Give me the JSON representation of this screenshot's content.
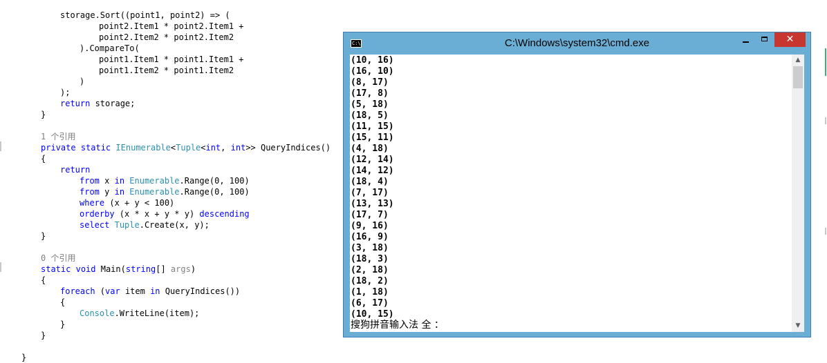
{
  "editor": {
    "lines": [
      {
        "segments": [
          {
            "t": "storage.Sort((point1, point2) => (",
            "c": ""
          }
        ]
      },
      {
        "segments": [
          {
            "t": "point2.Item1 * point2.Item1 +",
            "c": ""
          }
        ]
      },
      {
        "segments": [
          {
            "t": "point2.Item2 * point2.Item2",
            "c": ""
          }
        ]
      },
      {
        "segments": [
          {
            "t": ").CompareTo(",
            "c": ""
          }
        ]
      },
      {
        "segments": [
          {
            "t": "point1.Item1 * point1.Item1 +",
            "c": ""
          }
        ]
      },
      {
        "segments": [
          {
            "t": "point1.Item2 * point1.Item2",
            "c": ""
          }
        ]
      },
      {
        "segments": [
          {
            "t": ")",
            "c": ""
          }
        ]
      },
      {
        "segments": [
          {
            "t": ");",
            "c": ""
          }
        ]
      },
      {
        "segments": [
          {
            "t": "return",
            "c": "kw"
          },
          {
            "t": " storage;",
            "c": ""
          }
        ]
      },
      {
        "segments": [
          {
            "t": "}",
            "c": ""
          }
        ]
      },
      {
        "segments": [
          {
            "t": "1 个引用",
            "c": "gy"
          }
        ]
      },
      {
        "segments": [
          {
            "t": "private",
            "c": "kw"
          },
          {
            "t": " ",
            "c": ""
          },
          {
            "t": "static",
            "c": "kw"
          },
          {
            "t": " ",
            "c": ""
          },
          {
            "t": "IEnumerable",
            "c": "ty"
          },
          {
            "t": "<",
            "c": ""
          },
          {
            "t": "Tuple",
            "c": "ty"
          },
          {
            "t": "<",
            "c": ""
          },
          {
            "t": "int",
            "c": "kw"
          },
          {
            "t": ", ",
            "c": ""
          },
          {
            "t": "int",
            "c": "kw"
          },
          {
            "t": ">> QueryIndices()",
            "c": ""
          }
        ]
      },
      {
        "segments": [
          {
            "t": "{",
            "c": ""
          }
        ]
      },
      {
        "segments": [
          {
            "t": "return",
            "c": "kw"
          }
        ]
      },
      {
        "segments": [
          {
            "t": "from",
            "c": "kw"
          },
          {
            "t": " x ",
            "c": ""
          },
          {
            "t": "in",
            "c": "kw"
          },
          {
            "t": " ",
            "c": ""
          },
          {
            "t": "Enumerable",
            "c": "ty"
          },
          {
            "t": ".Range(0, 100)",
            "c": ""
          }
        ]
      },
      {
        "segments": [
          {
            "t": "from",
            "c": "kw"
          },
          {
            "t": " y ",
            "c": ""
          },
          {
            "t": "in",
            "c": "kw"
          },
          {
            "t": " ",
            "c": ""
          },
          {
            "t": "Enumerable",
            "c": "ty"
          },
          {
            "t": ".Range(0, 100)",
            "c": ""
          }
        ]
      },
      {
        "segments": [
          {
            "t": "where",
            "c": "kw"
          },
          {
            "t": " (x + y < 100)",
            "c": ""
          }
        ]
      },
      {
        "segments": [
          {
            "t": "orderby",
            "c": "kw"
          },
          {
            "t": " (x * x + y * y) ",
            "c": ""
          },
          {
            "t": "descending",
            "c": "kw"
          }
        ]
      },
      {
        "segments": [
          {
            "t": "select",
            "c": "kw"
          },
          {
            "t": " ",
            "c": ""
          },
          {
            "t": "Tuple",
            "c": "ty"
          },
          {
            "t": ".Create(x, y);",
            "c": ""
          }
        ]
      },
      {
        "segments": [
          {
            "t": "}",
            "c": ""
          }
        ]
      },
      {
        "segments": [
          {
            "t": "0 个引用",
            "c": "gy"
          }
        ]
      },
      {
        "segments": [
          {
            "t": "static",
            "c": "kw"
          },
          {
            "t": " ",
            "c": ""
          },
          {
            "t": "void",
            "c": "kw"
          },
          {
            "t": " Main(",
            "c": ""
          },
          {
            "t": "string",
            "c": "kw"
          },
          {
            "t": "[] ",
            "c": ""
          },
          {
            "t": "args",
            "c": "gy"
          },
          {
            "t": ")",
            "c": ""
          }
        ]
      },
      {
        "segments": [
          {
            "t": "{",
            "c": ""
          }
        ]
      },
      {
        "segments": [
          {
            "t": "foreach",
            "c": "kw"
          },
          {
            "t": " (",
            "c": ""
          },
          {
            "t": "var",
            "c": "kw"
          },
          {
            "t": " item ",
            "c": ""
          },
          {
            "t": "in",
            "c": "kw"
          },
          {
            "t": " QueryIndices())",
            "c": ""
          }
        ]
      },
      {
        "segments": [
          {
            "t": "{",
            "c": ""
          }
        ]
      },
      {
        "segments": [
          {
            "t": "Console",
            "c": "ty"
          },
          {
            "t": ".WriteLine(item);",
            "c": ""
          }
        ]
      },
      {
        "segments": [
          {
            "t": "}",
            "c": ""
          }
        ]
      },
      {
        "segments": [
          {
            "t": "}",
            "c": ""
          }
        ]
      },
      {
        "segments": [
          {
            "t": "}",
            "c": ""
          }
        ]
      }
    ]
  },
  "cmd": {
    "title": "C:\\Windows\\system32\\cmd.exe",
    "icon_text": "C:\\",
    "icon": "console-icon",
    "close_symbol": "✕",
    "scroll_up_symbol": "▲",
    "scroll_down_symbol": "▼",
    "output": [
      "(10, 16)",
      "(16, 10)",
      "(8, 17)",
      "(17, 8)",
      "(5, 18)",
      "(18, 5)",
      "(11, 15)",
      "(15, 11)",
      "(4, 18)",
      "(12, 14)",
      "(14, 12)",
      "(18, 4)",
      "(7, 17)",
      "(13, 13)",
      "(17, 7)",
      "(9, 16)",
      "(16, 9)",
      "(3, 18)",
      "(18, 3)",
      "(2, 18)",
      "(18, 2)",
      "(1, 18)",
      "(6, 17)",
      "(10, 15)"
    ],
    "ime_status": "搜狗拼音输入法 全 ："
  },
  "colors": {
    "keyword": "#0000ff",
    "type": "#2b91af",
    "comment": "#808080",
    "titlebar": "#6aaed6",
    "close_button": "#c7372f"
  }
}
